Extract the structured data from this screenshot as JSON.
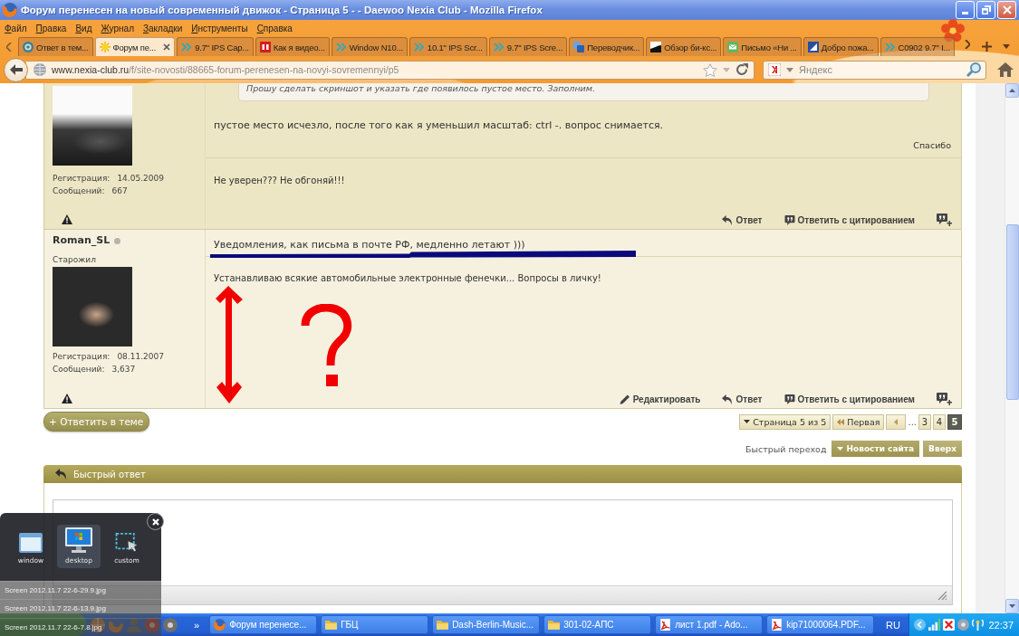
{
  "window": {
    "title": "Форум перенесен на новый современный движок - Страница 5 - - Daewoo Nexia Club - Mozilla Firefox"
  },
  "menu": [
    "Файл",
    "Правка",
    "Вид",
    "Журнал",
    "Закладки",
    "Инструменты",
    "Справка"
  ],
  "tabs": [
    {
      "kind": "portal",
      "label": "Ответ в тем...",
      "selected": false
    },
    {
      "kind": "forum",
      "label": "Форум пе...",
      "selected": true
    },
    {
      "kind": "shop",
      "label": "9.7\" IPS Cap...",
      "selected": false
    },
    {
      "kind": "blog",
      "label": "Как я видео...",
      "selected": false
    },
    {
      "kind": "shop",
      "label": "Window N10...",
      "selected": false
    },
    {
      "kind": "shop",
      "label": "10.1\" IPS Scr...",
      "selected": false
    },
    {
      "kind": "shop",
      "label": "9.7\" IPS Scre...",
      "selected": false
    },
    {
      "kind": "translator",
      "label": "Переводчик...",
      "selected": false
    },
    {
      "kind": "review",
      "label": "Обзор би-кс...",
      "selected": false
    },
    {
      "kind": "mail",
      "label": "Письмо «Ни ...",
      "selected": false
    },
    {
      "kind": "news",
      "label": "Добро пожа...",
      "selected": false
    },
    {
      "kind": "shop",
      "label": "C0902 9.7\" I...",
      "selected": false
    }
  ],
  "address_bar": {
    "url": "www.nexia-club.ru/f/site-novosti/88665-forum-perenesen-na-novyi-sovremennyi/p5"
  },
  "search": {
    "placeholder": "Яндекс"
  },
  "posts": [
    {
      "registration_label": "Регистрация:",
      "registration": "14.05.2009",
      "posts_label": "Сообщений:",
      "post_count": "667",
      "quote": "Прошу сделать скриншот и указать где появилось пустое место. Заполним.",
      "message": "пустое место исчезло, после того как я уменьшил масштаб: ctrl -. вопрос снимается.",
      "thanks": "Спасибо",
      "signature": "Не уверен??? Не обгоняй!!!",
      "actions": [
        {
          "kind": "reply",
          "label": "Ответ"
        },
        {
          "kind": "quote",
          "label": "Ответить с цитированием"
        },
        {
          "kind": "multiquote"
        }
      ]
    },
    {
      "author": "Roman_SL",
      "online": false,
      "rank": "Старожил",
      "registration_label": "Регистрация:",
      "registration": "08.11.2007",
      "posts_label": "Сообщений:",
      "post_count": "3,637",
      "title": "Уведомления, как письма в почте РФ, медленно летают )))",
      "signature": "Устанавливаю всякие автомобильные электронные фенечки... Вопросы в личку!",
      "annotations": [
        {
          "kind": "underline"
        },
        {
          "kind": "double_arrow"
        },
        {
          "kind": "question_mark"
        }
      ],
      "actions": [
        {
          "kind": "edit",
          "label": "Редактировать"
        },
        {
          "kind": "reply",
          "label": "Ответ"
        },
        {
          "kind": "quote",
          "label": "Ответить с цитированием"
        },
        {
          "kind": "multiquote"
        }
      ]
    }
  ],
  "thread_controls": {
    "reply_button": "+ Ответить в теме",
    "pagination": {
      "label": "Страница 5 из 5",
      "first": "Первая",
      "ellipsis": "...",
      "pages": [
        {
          "label": "3",
          "selected": false
        },
        {
          "label": "4",
          "selected": false
        },
        {
          "label": "5",
          "selected": true
        }
      ]
    },
    "quick_nav": {
      "label": "Быстрый переход",
      "forum": "Новости сайта",
      "top": "Вверх"
    }
  },
  "quick_reply": {
    "title": "Быстрый ответ"
  },
  "screenshot_tool": {
    "modes": [
      {
        "kind": "window",
        "label": "window",
        "selected": false
      },
      {
        "kind": "desktop",
        "label": "desktop",
        "selected": true
      },
      {
        "kind": "custom",
        "label": "custom",
        "selected": false
      }
    ],
    "files": [
      "Screen 2012.11.7 22-6-29.9.jpg",
      "Screen 2012.11.7 22-6-13.9.jpg",
      "Screen 2012.11.7 22-6-7.8.jpg"
    ]
  },
  "taskbar": {
    "more": "»",
    "tasks": [
      {
        "kind": "browser",
        "label": "Форум перенесе..."
      },
      {
        "kind": "folder",
        "label": "ГБЦ"
      },
      {
        "kind": "folder",
        "label": "Dash-Berlin-Music..."
      },
      {
        "kind": "folder",
        "label": "301-02-АПС"
      },
      {
        "kind": "pdf",
        "label": "лист 1.pdf - Ado..."
      },
      {
        "kind": "pdf",
        "label": "kip71000064.PDF..."
      }
    ],
    "language": "RU",
    "clock": "22:37"
  }
}
